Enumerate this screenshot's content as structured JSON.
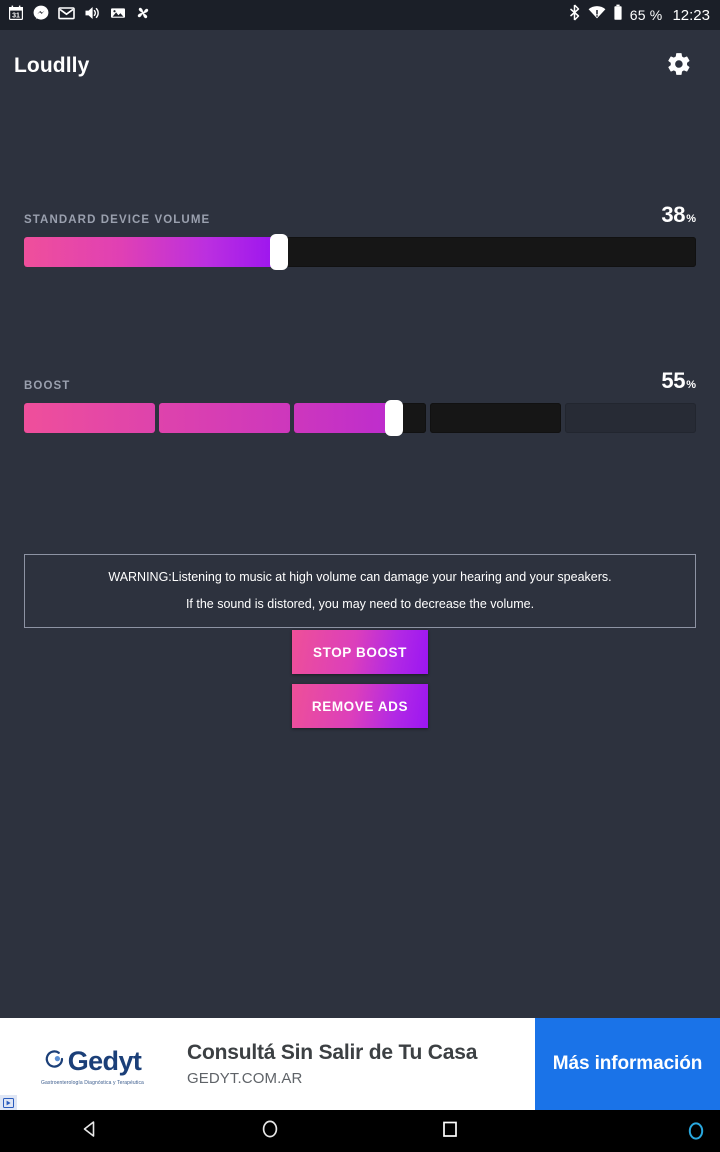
{
  "statusbar": {
    "left_icons": [
      {
        "name": "calendar-icon",
        "label": "31"
      },
      {
        "name": "messenger-icon",
        "label": ""
      },
      {
        "name": "gmail-icon",
        "label": "M"
      },
      {
        "name": "volume-icon",
        "label": ""
      },
      {
        "name": "photos-icon",
        "label": ""
      },
      {
        "name": "pinwheel-icon",
        "label": ""
      }
    ],
    "bluetooth_icon": "bluetooth-icon",
    "wifi_icon": "wifi-warning-icon",
    "battery_icon": "battery-icon",
    "battery_percent": "65 %",
    "clock": "12:23"
  },
  "appbar": {
    "title": "Loudlly",
    "settings_icon": "gear-icon"
  },
  "sliders": [
    {
      "id": "standard",
      "label": "STANDARD DEVICE VOLUME",
      "value": 38,
      "value_text": "38",
      "unit": "%",
      "type": "continuous"
    },
    {
      "id": "boost",
      "label": "BOOST",
      "value": 55,
      "value_text": "55",
      "unit": "%",
      "type": "segmented",
      "segments": 5
    }
  ],
  "warning": {
    "line1": "WARNING:Listening to music at high volume can damage your hearing and your speakers.",
    "line2": "If the sound is distored, you may need to decrease the volume."
  },
  "buttons": {
    "stop_boost": "STOP BOOST",
    "remove_ads": "REMOVE ADS"
  },
  "ad": {
    "logo_text": "Gedyt",
    "logo_icon": "gedyt-circle-icon",
    "logo_subtitle": "Gastroenterología\nDiagnóstica y Terapéutica",
    "headline": "Consultá Sin Salir de Tu Casa",
    "url": "GEDYT.COM.AR",
    "cta": "Más información",
    "adchoices_icon": "adchoices-icon"
  },
  "navbar": {
    "back_icon": "back-triangle-icon",
    "home_icon": "home-circle-icon",
    "recents_icon": "recents-square-icon",
    "assistant_icon": "assistant-circle-icon"
  },
  "colors": {
    "background": "#2d323e",
    "statusbar_bg": "#1b1f28",
    "gradient_start": "#ef4f9b",
    "gradient_end": "#9b14f0",
    "track_empty": "#161616",
    "label_text": "#9aa0ae",
    "ad_cta_bg": "#1a73e8",
    "ad_logo_blue": "#1b3f78",
    "assistant_blue": "#29a8df"
  }
}
